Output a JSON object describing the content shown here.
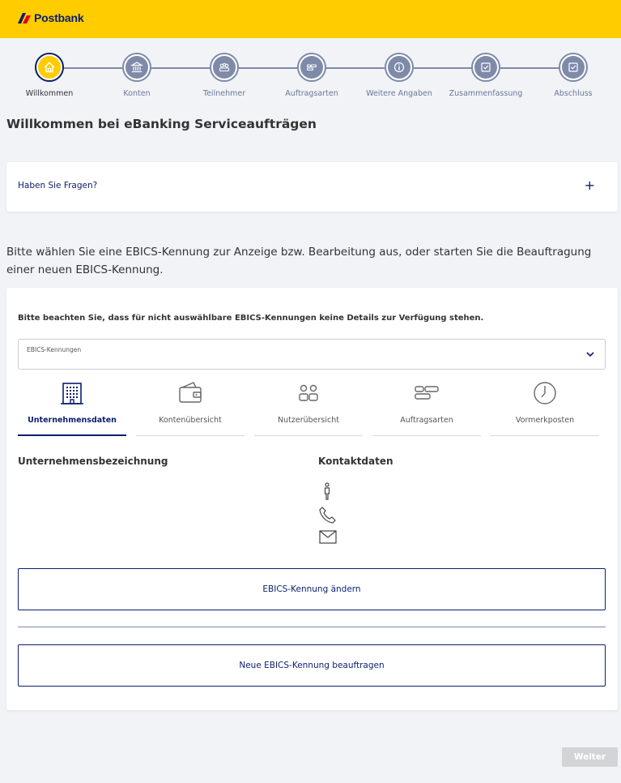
{
  "brand": {
    "name": "Postbank",
    "color": "#ffcc00",
    "accent": "#0a1e6e"
  },
  "stepper": {
    "steps": [
      {
        "label": "Willkommen",
        "icon": "home-icon",
        "active": true
      },
      {
        "label": "Konten",
        "icon": "bank-icon",
        "active": false
      },
      {
        "label": "Teilnehmer",
        "icon": "users-icon",
        "active": false
      },
      {
        "label": "Auftragsarten",
        "icon": "order-types-icon",
        "active": false
      },
      {
        "label": "Weitere Angaben",
        "icon": "info-icon",
        "active": false
      },
      {
        "label": "Zusammenfassung",
        "icon": "checkbox-icon",
        "active": false
      },
      {
        "label": "Abschluss",
        "icon": "checkbox-icon",
        "active": false
      }
    ]
  },
  "page": {
    "title": "Willkommen bei eBanking Serviceaufträgen",
    "faq_label": "Haben Sie Fragen?",
    "faq_toggle": "+",
    "intro": "Bitte wählen Sie eine EBICS-Kennung zur Anzeige bzw. Bearbeitung aus, oder starten Sie die Beauftragung einer neuen EBICS-Kennung."
  },
  "card": {
    "note": "Bitte beachten Sie, dass für nicht auswählbare EBICS-Kennungen keine Details zur Verfügung stehen.",
    "select_label": "EBICS-Kennungen",
    "tabs": [
      {
        "label": "Unternehmensdaten",
        "icon": "building-icon",
        "active": true
      },
      {
        "label": "Kontenübersicht",
        "icon": "wallet-icon",
        "active": false
      },
      {
        "label": "Nutzerübersicht",
        "icon": "users-icon",
        "active": false
      },
      {
        "label": "Auftragsarten",
        "icon": "order-types-icon",
        "active": false
      },
      {
        "label": "Vormerkposten",
        "icon": "clock-icon",
        "active": false
      }
    ],
    "company_heading": "Unternehmensbezeichnung",
    "contact_heading": "Kontaktdaten",
    "change_button": "EBICS-Kennung ändern",
    "new_button": "Neue EBICS-Kennung beauftragen"
  },
  "footer": {
    "next_button": "Weiter"
  }
}
